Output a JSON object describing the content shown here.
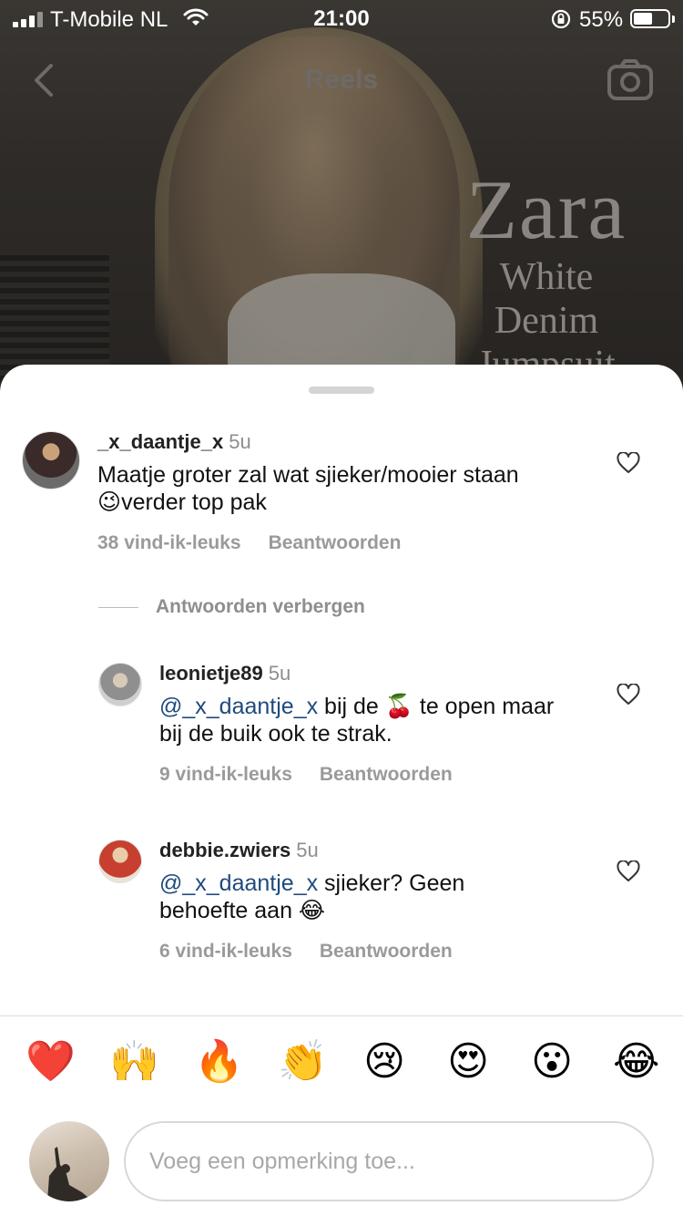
{
  "status_bar": {
    "carrier": "T-Mobile NL",
    "time": "21:00",
    "battery_percent": "55%",
    "battery_level": 0.55
  },
  "video": {
    "title": "Reels",
    "overlay_lines": [
      "Zara",
      "White",
      "Denim",
      "Jumpsuit"
    ]
  },
  "comments": [
    {
      "username": "_x_daantje_x",
      "time": "5u",
      "mention": "",
      "text_part1": "Maatje groter zal wat sjieker/mooier staan",
      "emoji1": "😉",
      "text_part2": "verder top pak",
      "likes": "38 vind-ik-leuks",
      "reply": "Beantwoorden"
    },
    {
      "username": "leonietje89",
      "time": "5u",
      "mention": "@_x_daantje_x",
      "text_part1": " bij de ",
      "emoji1": "🍒",
      "text_part2": " te open maar bij de buik ook te strak.",
      "likes": "9 vind-ik-leuks",
      "reply": "Beantwoorden"
    },
    {
      "username": "debbie.zwiers",
      "time": "5u",
      "mention": "@_x_daantje_x",
      "text_part1": " sjieker? Geen behoefte aan ",
      "emoji1": "😂",
      "text_part2": "",
      "likes": "6 vind-ik-leuks",
      "reply": "Beantwoorden"
    }
  ],
  "hide_replies_label": "Antwoorden verbergen",
  "emoji_bar": [
    "❤️",
    "🙌",
    "🔥",
    "👏",
    "😢",
    "😍",
    "😮",
    "😂"
  ],
  "input": {
    "placeholder": "Voeg een opmerking toe..."
  }
}
